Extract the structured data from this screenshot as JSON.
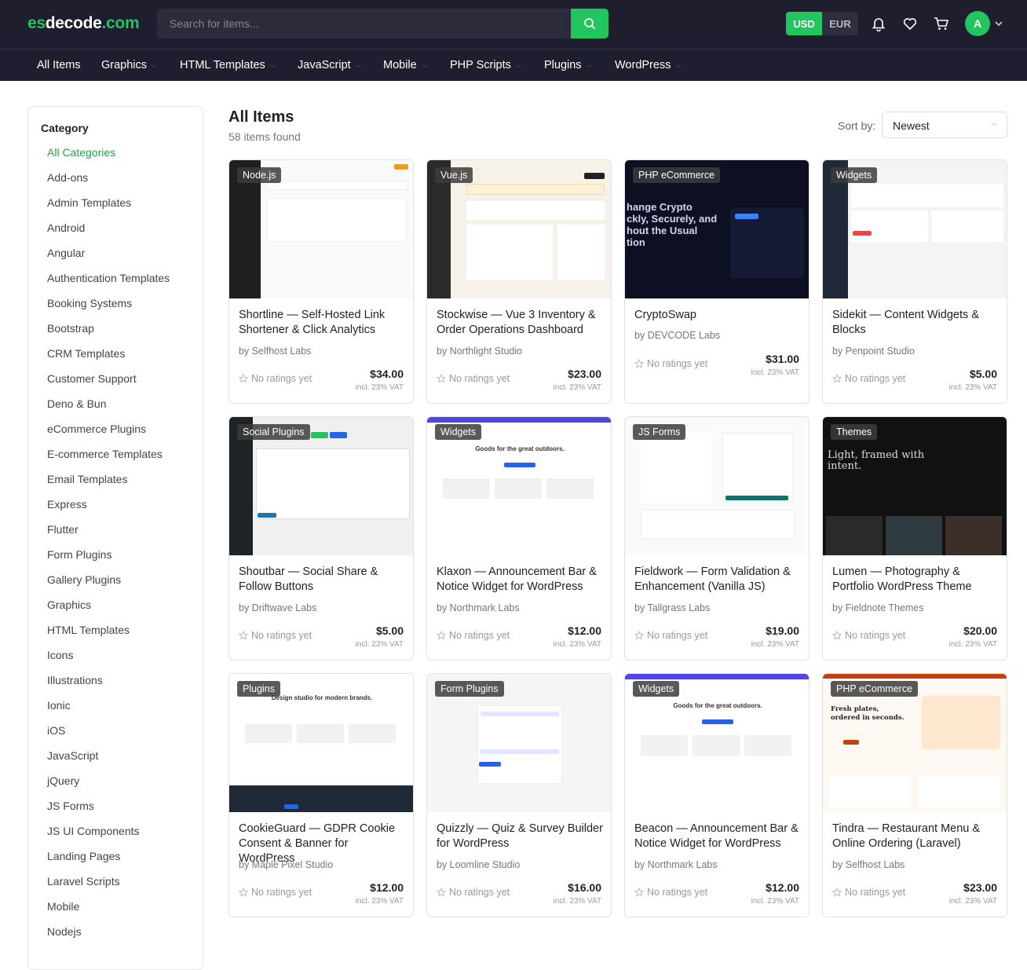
{
  "brand": {
    "prefix": "es",
    "mid": "decode",
    "suffix": ".com"
  },
  "search": {
    "placeholder": "Search for items..."
  },
  "currency": {
    "active": "USD",
    "other": "EUR"
  },
  "user": {
    "initial": "A"
  },
  "nav": [
    "All Items",
    "Graphics",
    "HTML Templates",
    "JavaScript",
    "Mobile",
    "PHP Scripts",
    "Plugins",
    "WordPress"
  ],
  "sidebar": {
    "heading": "Category",
    "items": [
      "All Categories",
      "Add-ons",
      "Admin Templates",
      "Android",
      "Angular",
      "Authentication Templates",
      "Booking Systems",
      "Bootstrap",
      "CRM Templates",
      "Customer Support",
      "Deno & Bun",
      "eCommerce Plugins",
      "E-commerce Templates",
      "Email Templates",
      "Express",
      "Flutter",
      "Form Plugins",
      "Gallery Plugins",
      "Graphics",
      "HTML Templates",
      "Icons",
      "Illustrations",
      "Ionic",
      "iOS",
      "JavaScript",
      "jQuery",
      "JS Forms",
      "JS UI Components",
      "Landing Pages",
      "Laravel Scripts",
      "Mobile",
      "Nodejs"
    ]
  },
  "main": {
    "title": "All Items",
    "count": "58 items found",
    "sort_label": "Sort by:",
    "sort_value": "Newest"
  },
  "products": [
    {
      "badge": "Node.js",
      "title": "Shortline — Self-Hosted Link Shortener & Click Analytics",
      "by": "by Selfhost Labs",
      "rating": "No ratings yet",
      "price": "$34.00",
      "vat": "incl. 23% VAT",
      "theme": "light-sidebar"
    },
    {
      "badge": "Vue.js",
      "title": "Stockwise — Vue 3 Inventory & Order Operations Dashboard",
      "by": "by Northlight Studio",
      "rating": "No ratings yet",
      "price": "$23.00",
      "vat": "incl. 23% VAT",
      "theme": "cream"
    },
    {
      "badge": "PHP eCommerce",
      "title": "CryptoSwap",
      "by": "by DEVCODE Labs",
      "rating": "No ratings yet",
      "price": "$31.00",
      "vat": "incl. 23% VAT",
      "theme": "dark-crypto"
    },
    {
      "badge": "Widgets",
      "title": "Sidekit — Content Widgets & Blocks",
      "by": "by Penpoint Studio",
      "rating": "No ratings yet",
      "price": "$5.00",
      "vat": "incl. 23% VAT",
      "theme": "widgets"
    },
    {
      "badge": "Social Plugins",
      "title": "Shoutbar — Social Share & Follow Buttons",
      "by": "by Driftwave Labs",
      "rating": "No ratings yet",
      "price": "$5.00",
      "vat": "incl. 23% VAT",
      "theme": "wp-admin"
    },
    {
      "badge": "Widgets",
      "title": "Klaxon — Announcement Bar & Notice Widget for WordPress",
      "by": "by Northmark Labs",
      "rating": "No ratings yet",
      "price": "$12.00",
      "vat": "incl. 23% VAT",
      "theme": "announce"
    },
    {
      "badge": "JS Forms",
      "title": "Fieldwork — Form Validation & Enhancement (Vanilla JS)",
      "by": "by Tallgrass Labs",
      "rating": "No ratings yet",
      "price": "$19.00",
      "vat": "incl. 23% VAT",
      "theme": "forms"
    },
    {
      "badge": "Themes",
      "title": "Lumen — Photography & Portfolio WordPress Theme",
      "by": "by Fieldnote Themes",
      "rating": "No ratings yet",
      "price": "$20.00",
      "vat": "incl. 23% VAT",
      "theme": "dark-photo"
    },
    {
      "badge": "Plugins",
      "title": "CookieGuard — GDPR Cookie Consent & Banner for WordPress",
      "by": "by Maple Pixel Studio",
      "rating": "No ratings yet",
      "price": "$12.00",
      "vat": "incl. 23% VAT",
      "theme": "cookie"
    },
    {
      "badge": "Form Plugins",
      "title": "Quizzly — Quiz & Survey Builder for WordPress",
      "by": "by Loomline Studio",
      "rating": "No ratings yet",
      "price": "$16.00",
      "vat": "incl. 23% VAT",
      "theme": "quiz"
    },
    {
      "badge": "Widgets",
      "title": "Beacon — Announcement Bar & Notice Widget for WordPress",
      "by": "by Northmark Labs",
      "rating": "No ratings yet",
      "price": "$12.00",
      "vat": "incl. 23% VAT",
      "theme": "announce"
    },
    {
      "badge": "PHP eCommerce",
      "title": "Tindra — Restaurant Menu & Online Ordering (Laravel)",
      "by": "by Selfhost Labs",
      "rating": "No ratings yet",
      "price": "$23.00",
      "vat": "incl. 23% VAT",
      "theme": "restaurant"
    }
  ],
  "colors": {
    "accent": "#22c55e",
    "topbar": "#1e1e2e"
  }
}
